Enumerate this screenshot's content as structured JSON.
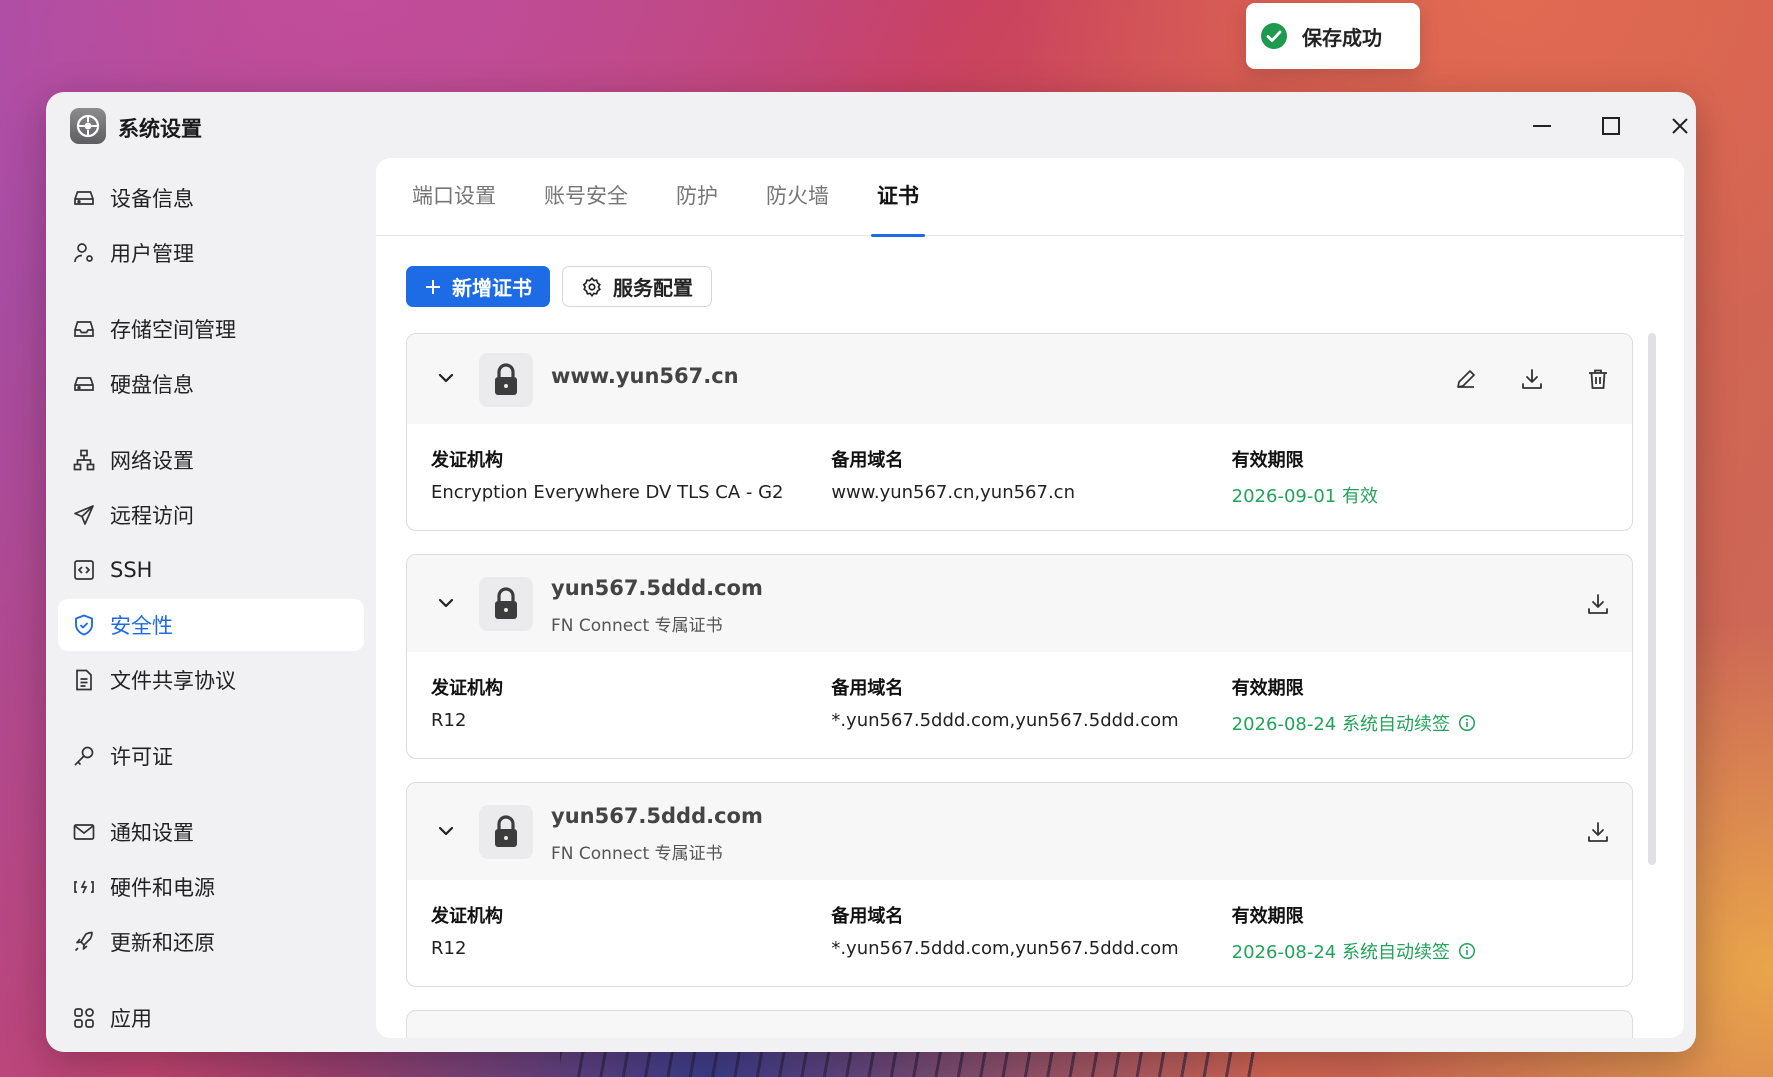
{
  "toast": {
    "text": "保存成功",
    "icon": "check-circle-icon",
    "color": "#1e9a4e"
  },
  "window": {
    "title": "系统设置",
    "controls": [
      "minimize",
      "maximize",
      "close"
    ]
  },
  "sidebar": {
    "items": [
      {
        "label": "设备信息",
        "icon": "drive-icon"
      },
      {
        "label": "用户管理",
        "icon": "user-settings-icon"
      },
      {
        "label": "存储空间管理",
        "icon": "inbox-icon"
      },
      {
        "label": "硬盘信息",
        "icon": "drive-icon"
      },
      {
        "label": "网络设置",
        "icon": "network-icon"
      },
      {
        "label": "远程访问",
        "icon": "send-icon"
      },
      {
        "label": "SSH",
        "icon": "code-box-icon"
      },
      {
        "label": "安全性",
        "icon": "shield-check-icon",
        "active": true
      },
      {
        "label": "文件共享协议",
        "icon": "document-icon"
      },
      {
        "label": "许可证",
        "icon": "key-icon"
      },
      {
        "label": "通知设置",
        "icon": "mail-icon"
      },
      {
        "label": "硬件和电源",
        "icon": "power-plug-icon"
      },
      {
        "label": "更新和还原",
        "icon": "rocket-icon"
      },
      {
        "label": "应用",
        "icon": "apps-grid-icon"
      }
    ]
  },
  "tabs": [
    {
      "label": "端口设置"
    },
    {
      "label": "账号安全"
    },
    {
      "label": "防护"
    },
    {
      "label": "防火墙"
    },
    {
      "label": "证书",
      "active": true
    }
  ],
  "toolbar": {
    "add_label": "新增证书",
    "config_label": "服务配置"
  },
  "columns": {
    "issuer": "发证机构",
    "alt_names": "备用域名",
    "validity": "有效期限"
  },
  "certs": [
    {
      "domain": "www.yun567.cn",
      "subtitle": "",
      "issuer": "Encryption Everywhere DV TLS CA - G2",
      "alt_names": "www.yun567.cn,yun567.cn",
      "validity": "2026-09-01 有效",
      "actions": [
        "edit",
        "download",
        "delete"
      ]
    },
    {
      "domain": "yun567.5ddd.com",
      "subtitle": "FN Connect 专属证书",
      "issuer": "R12",
      "alt_names": "*.yun567.5ddd.com,yun567.5ddd.com",
      "validity": "2026-08-24 系统自动续签",
      "actions": [
        "download"
      ]
    },
    {
      "domain": "yun567.5ddd.com",
      "subtitle": "FN Connect 专属证书",
      "issuer": "R12",
      "alt_names": "*.yun567.5ddd.com,yun567.5ddd.com",
      "validity": "2026-08-24 系统自动续签",
      "actions": [
        "download"
      ]
    }
  ],
  "colors": {
    "accent": "#1e6be6",
    "valid_green": "#22a35a"
  }
}
